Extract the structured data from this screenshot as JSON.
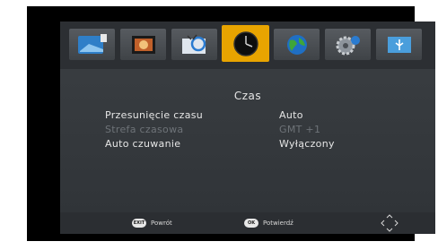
{
  "tabs": [
    {
      "icon": "tv-channels-icon"
    },
    {
      "icon": "picture-icon"
    },
    {
      "icon": "search-icon"
    },
    {
      "icon": "clock-icon",
      "active": true
    },
    {
      "icon": "globe-icon"
    },
    {
      "icon": "settings-icon"
    },
    {
      "icon": "usb-icon"
    }
  ],
  "accent_color": "#e8a400",
  "page": {
    "title": "Czas"
  },
  "settings": [
    {
      "label": "Przesunięcie czasu",
      "value": "Auto",
      "enabled": true
    },
    {
      "label": "Strefa czasowa",
      "value": "GMT +1",
      "enabled": false
    },
    {
      "label": "Auto czuwanie",
      "value": "Wyłączony",
      "enabled": true
    }
  ],
  "footer": {
    "back": {
      "key": "EXIT",
      "label": "Powrót"
    },
    "confirm": {
      "key": "OK",
      "label": "Potwierdź"
    },
    "nav_icon": "dpad-arrows-icon"
  }
}
